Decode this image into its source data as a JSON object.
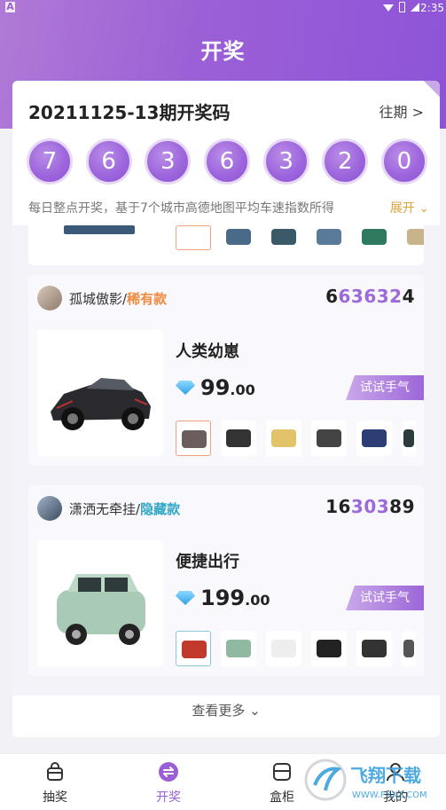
{
  "status": {
    "a_badge": "A",
    "time": "2:35"
  },
  "header": {
    "title": "开奖"
  },
  "draw": {
    "period_title": "20211125-13期开奖码",
    "history_label": "往期 >",
    "balls": [
      "7",
      "6",
      "3",
      "6",
      "3",
      "2",
      "0"
    ],
    "description": "每日整点开奖，基于7个城市高德地图平均车速指数所得",
    "expand_label": "展开 ⌄"
  },
  "items": [
    {
      "username": "孤城傲影/",
      "tag": "稀有款",
      "code_plain_prefix": "6",
      "code_highlight": "63632",
      "code_plain_suffix": "4",
      "product_name": "人类幼崽",
      "price_main": "99",
      "price_decimal": ".00",
      "try_label": "试试手气",
      "thumb_colors": [
        "#6b5d5d",
        "#333333",
        "#e2c36a",
        "#444444",
        "#2c3e73",
        "#2c3b3b"
      ]
    },
    {
      "username": "潇洒无牵挂/",
      "tag": "隐藏款",
      "code_plain_prefix": "16",
      "code_highlight": "303",
      "code_plain_suffix": "89",
      "product_name": "便捷出行",
      "price_main": "199",
      "price_decimal": ".00",
      "try_label": "试试手气",
      "thumb_colors": [
        "#c0392b",
        "#8fb9a0",
        "#eeeeee",
        "#222222",
        "#333333",
        "#555555"
      ]
    }
  ],
  "see_more": "查看更多 ⌄",
  "tabs": [
    {
      "label": "抽奖",
      "icon": "gift-bag-icon"
    },
    {
      "label": "开奖",
      "icon": "exchange-icon"
    },
    {
      "label": "盒柜",
      "icon": "box-icon"
    },
    {
      "label": "我的",
      "icon": "user-icon"
    }
  ],
  "colors": {
    "primary": "#9a5fd6",
    "rare_tag": "#f08a3c",
    "hidden_tag": "#31a7c7",
    "expand": "#e0a23a"
  },
  "watermark": {
    "text": "飞翔下载",
    "url": "WWW.FXXZ.COM"
  }
}
